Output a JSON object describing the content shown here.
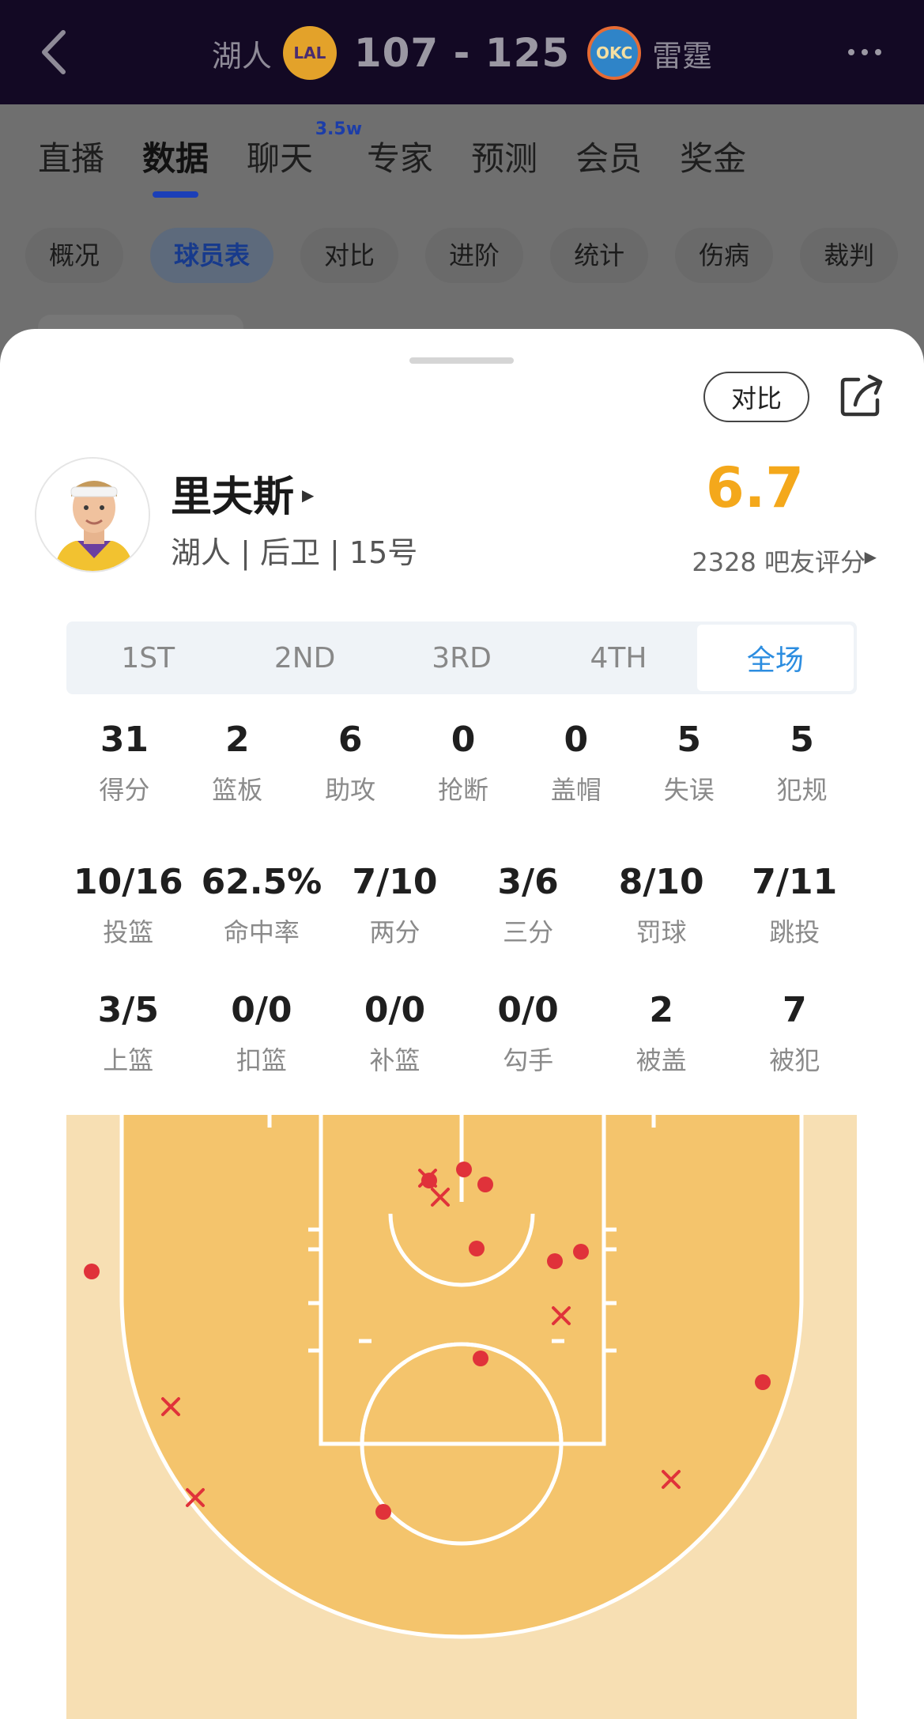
{
  "header": {
    "home_team": "湖人",
    "home_abbr": "LAL",
    "score": "107 - 125",
    "away_abbr": "OKC",
    "away_team": "雷霆"
  },
  "tabs": [
    {
      "label": "直播"
    },
    {
      "label": "数据"
    },
    {
      "label": "聊天",
      "badge": "3.5w"
    },
    {
      "label": "专家"
    },
    {
      "label": "预测"
    },
    {
      "label": "会员"
    },
    {
      "label": "奖金"
    }
  ],
  "subtabs": [
    "概况",
    "球员表",
    "对比",
    "进阶",
    "统计",
    "伤病",
    "裁判"
  ],
  "sheet": {
    "compare_label": "对比",
    "player": {
      "name": "里夫斯",
      "meta": "湖人 | 后卫 | 15号",
      "rating": "6.7",
      "rating_count": "2328 吧友评分"
    },
    "periods": [
      "1ST",
      "2ND",
      "3RD",
      "4TH",
      "全场"
    ],
    "active_period": "全场",
    "stats_row1": [
      {
        "value": "31",
        "label": "得分"
      },
      {
        "value": "2",
        "label": "篮板"
      },
      {
        "value": "6",
        "label": "助攻"
      },
      {
        "value": "0",
        "label": "抢断"
      },
      {
        "value": "0",
        "label": "盖帽"
      },
      {
        "value": "5",
        "label": "失误"
      },
      {
        "value": "5",
        "label": "犯规"
      }
    ],
    "stats_row2": [
      {
        "value": "10/16",
        "label": "投篮"
      },
      {
        "value": "62.5%",
        "label": "命中率"
      },
      {
        "value": "7/10",
        "label": "两分"
      },
      {
        "value": "3/6",
        "label": "三分"
      },
      {
        "value": "8/10",
        "label": "罚球"
      },
      {
        "value": "7/11",
        "label": "跳投"
      }
    ],
    "stats_row3": [
      {
        "value": "3/5",
        "label": "上篮"
      },
      {
        "value": "0/0",
        "label": "扣篮"
      },
      {
        "value": "0/0",
        "label": "补篮"
      },
      {
        "value": "0/0",
        "label": "勾手"
      },
      {
        "value": "2",
        "label": "被盖"
      },
      {
        "value": "7",
        "label": "被犯"
      }
    ]
  },
  "colors": {
    "navbar": "#130924",
    "rating": "#f4a81b",
    "active_period": "#2c8de0",
    "made_shot": "#e0323a",
    "missed_shot": "#e0323a",
    "court_paint": "#f4c46c",
    "court_outside": "#f7dfb3"
  },
  "icons": [
    "back-icon",
    "more-icon",
    "share-icon",
    "play-arrow-icon"
  ]
}
